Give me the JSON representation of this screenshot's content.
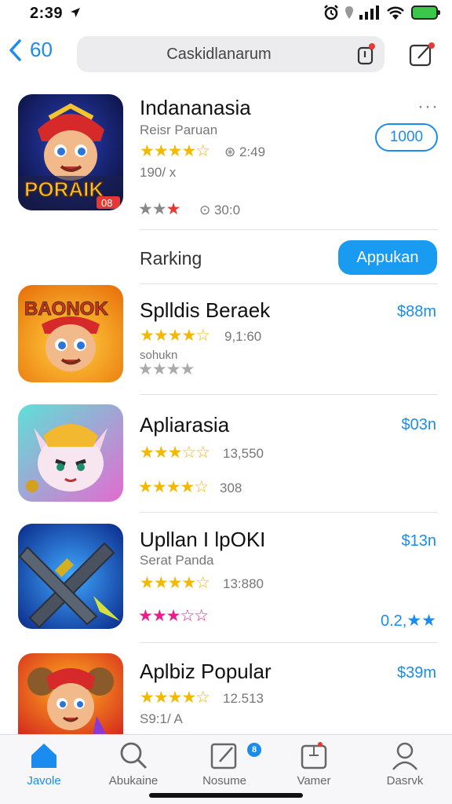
{
  "status": {
    "time": "2:39"
  },
  "nav": {
    "back_label": "60",
    "search_value": "Caskidlanarum"
  },
  "featured": {
    "title": "Indananasia",
    "subtitle": "Reisr Paruan",
    "rating_count": "2:49",
    "size": "190/ x",
    "small_count": "30:0",
    "action_label": "1000",
    "more": "···"
  },
  "ranking": {
    "label": "Rarking",
    "button_label": "Appukan"
  },
  "apps": [
    {
      "title": "Splldis Beraek",
      "rating_count": "9,1:60",
      "sub": "sohukn",
      "price": "$88m"
    },
    {
      "title": "Apliarasia",
      "rating_count": "13,550",
      "sub_count": "308",
      "price": "$03n"
    },
    {
      "title": "Upllan I lpOKI",
      "subtitle": "Serat Panda",
      "rating_count": "13:880",
      "extra": "0.2,",
      "price": "$13n"
    },
    {
      "title": "Aplbiz Popular",
      "rating_count": "12.513",
      "sub": "S9:1/ A",
      "price": "$39m"
    }
  ],
  "icons": {
    "featured_text": "PORAIK",
    "featured_badge": "08",
    "app1_text": "BAONOK"
  },
  "tabs": [
    {
      "label": "Javole"
    },
    {
      "label": "Abukaine"
    },
    {
      "label": "Nosume"
    },
    {
      "label": "Vamer"
    },
    {
      "label": "Dasrvk"
    }
  ],
  "tab_badge": "8",
  "colors": {
    "accent": "#1a8cf0",
    "star": "#f5b800",
    "star_red": "#e53935",
    "star_pink": "#e91e8c",
    "star_blue": "#1a8cf0"
  }
}
